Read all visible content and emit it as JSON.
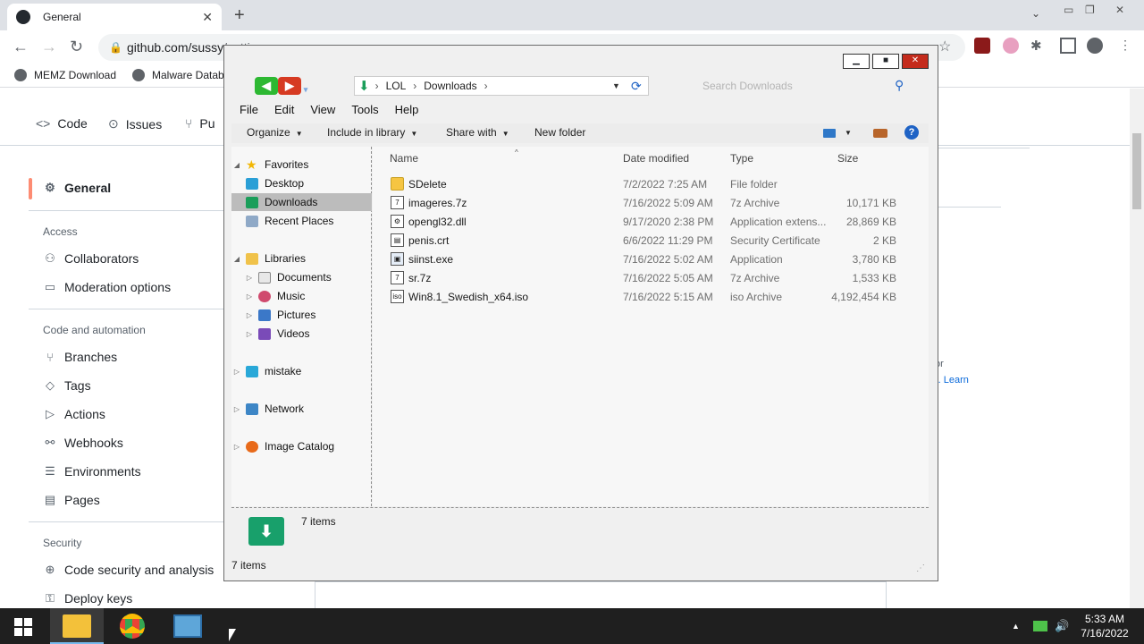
{
  "browser": {
    "tab_title": "General",
    "url": "github.com/sussy",
    "url_frag": "/settings",
    "bookmarks": [
      "MEMZ Download",
      "Malware Datab"
    ]
  },
  "github": {
    "nav_tabs": [
      "Code",
      "Issues",
      "Pu"
    ],
    "sidebar": {
      "general": "General",
      "access_heading": "Access",
      "collaborators": "Collaborators",
      "moderation": "Moderation options",
      "code_automation_heading": "Code and automation",
      "branches": "Branches",
      "tags": "Tags",
      "actions": "Actions",
      "webhooks": "Webhooks",
      "environments": "Environments",
      "pages": "Pages",
      "security_heading": "Security",
      "code_security": "Code security and analysis",
      "deploy_keys": "Deploy keys"
    },
    "frag_or": "or",
    "frag_paren": "). ",
    "frag_learn": "Learn"
  },
  "explorer": {
    "path": [
      "LOL",
      "Downloads"
    ],
    "search_placeholder": "Search Downloads",
    "menu": [
      "File",
      "Edit",
      "View",
      "Tools",
      "Help"
    ],
    "commands": {
      "organize": "Organize",
      "include": "Include in library",
      "share": "Share with",
      "new_folder": "New folder"
    },
    "nav": {
      "favorites": "Favorites",
      "desktop": "Desktop",
      "downloads": "Downloads",
      "recent": "Recent Places",
      "libraries": "Libraries",
      "documents": "Documents",
      "music": "Music",
      "pictures": "Pictures",
      "videos": "Videos",
      "mistake": "mistake",
      "network": "Network",
      "image_catalog": "Image Catalog"
    },
    "columns": {
      "name": "Name",
      "date": "Date modified",
      "type": "Type",
      "size": "Size"
    },
    "files": [
      {
        "name": "SDelete",
        "date": "7/2/2022 7:25 AM",
        "type": "File folder",
        "size": ""
      },
      {
        "name": "imageres.7z",
        "date": "7/16/2022 5:09 AM",
        "type": "7z Archive",
        "size": "10,171 KB"
      },
      {
        "name": "opengl32.dll",
        "date": "9/17/2020 2:38 PM",
        "type": "Application extens...",
        "size": "28,869 KB"
      },
      {
        "name": "penis.crt",
        "date": "6/6/2022 11:29 PM",
        "type": "Security Certificate",
        "size": "2 KB"
      },
      {
        "name": "siinst.exe",
        "date": "7/16/2022 5:02 AM",
        "type": "Application",
        "size": "3,780 KB"
      },
      {
        "name": "sr.7z",
        "date": "7/16/2022 5:05 AM",
        "type": "7z Archive",
        "size": "1,533 KB"
      },
      {
        "name": "Win8.1_Swedish_x64.iso",
        "date": "7/16/2022 5:15 AM",
        "type": "iso Archive",
        "size": "4,192,454 KB"
      }
    ],
    "details_count": "7 items",
    "status": "7 items"
  },
  "taskbar": {
    "time": "5:33 AM",
    "date": "7/16/2022"
  }
}
